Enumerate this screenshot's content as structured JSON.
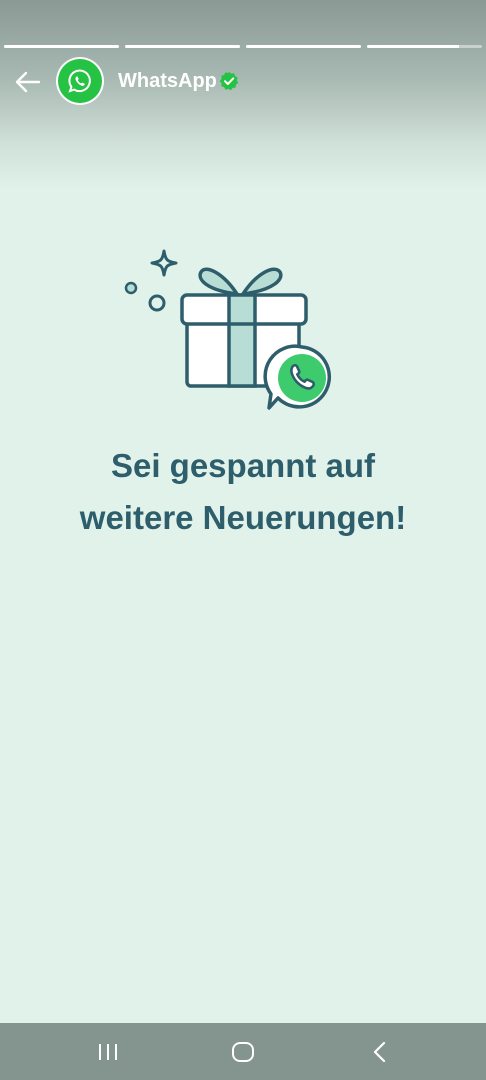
{
  "story": {
    "progress_segments": [
      1,
      1,
      1,
      0.8
    ]
  },
  "header": {
    "back_icon": "arrow-left-icon",
    "avatar_icon": "whatsapp-logo-icon",
    "channel_name": "WhatsApp",
    "verified_icon": "verified-badge-icon",
    "verified_color": "#25c244"
  },
  "content": {
    "illustration_icon": "gift-box-whatsapp-icon",
    "headline_line1": "Sei gespannt auf",
    "headline_line2": "weitere Neuerungen!"
  },
  "colors": {
    "background": "#e1f2ea",
    "headline": "#2e5e6b",
    "brand_green": "#25c244",
    "illustration_outline": "#2e5e6b",
    "illustration_ribbon": "#b8ddd4"
  },
  "system_nav": {
    "recents_icon": "recents-icon",
    "home_icon": "home-icon",
    "back_icon": "nav-back-icon"
  }
}
